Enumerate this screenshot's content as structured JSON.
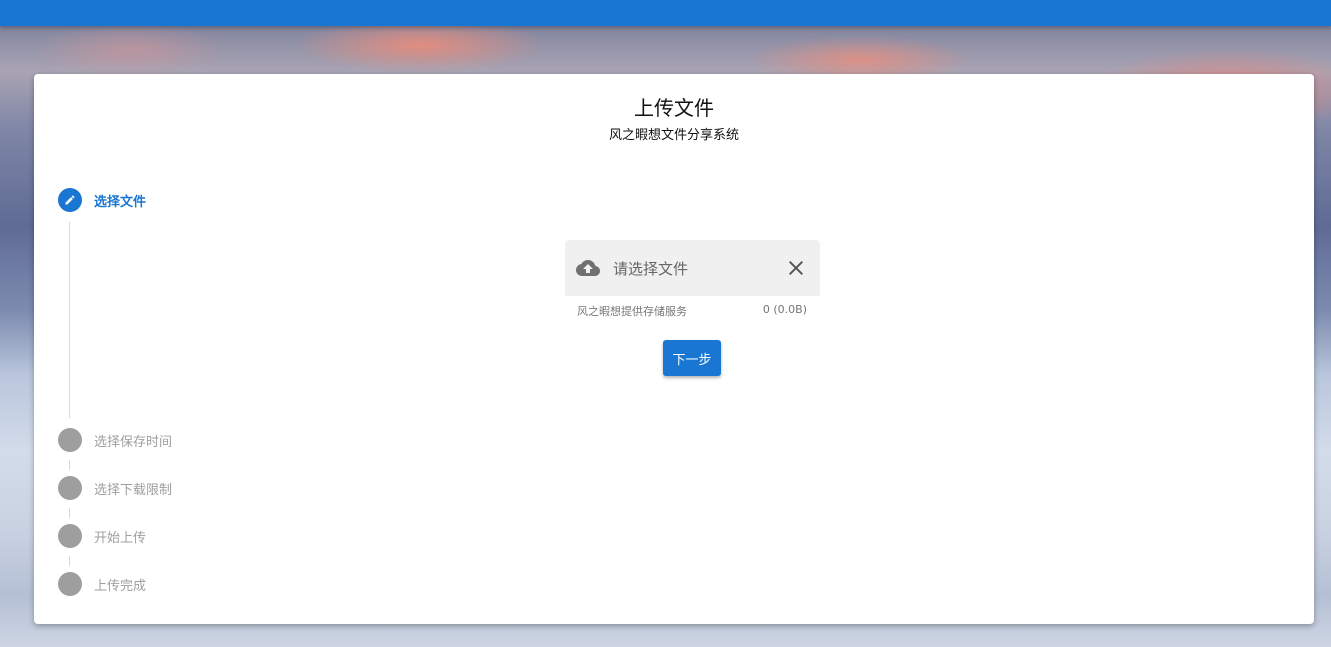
{
  "page": {
    "title": "上传文件",
    "subtitle": "风之暇想文件分享系统"
  },
  "steps": [
    {
      "label": "选择文件",
      "state": "active",
      "icon": "pencil-icon"
    },
    {
      "label": "选择保存时间",
      "state": "inactive"
    },
    {
      "label": "选择下载限制",
      "state": "inactive"
    },
    {
      "label": "开始上传",
      "state": "inactive"
    },
    {
      "label": "上传完成",
      "state": "inactive"
    }
  ],
  "file_input": {
    "placeholder": "请选择文件",
    "prepend_icon": "cloud-upload-icon",
    "clear_icon": "close-icon",
    "hint": "风之暇想提供存储服务",
    "counter": "0 (0.0B)"
  },
  "actions": {
    "next_label": "下一步"
  },
  "colors": {
    "primary": "#1976d2",
    "inactive": "#9e9e9e",
    "field_bg": "#f0f0f0"
  }
}
